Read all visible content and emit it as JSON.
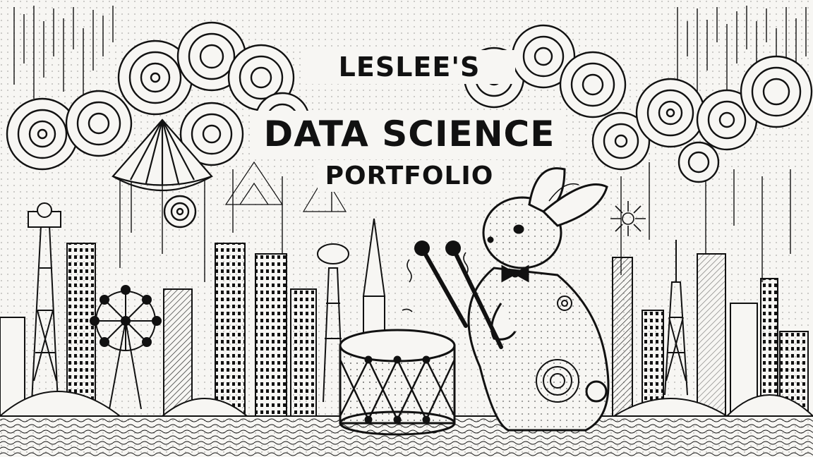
{
  "title": {
    "line1": "LESLEE'S",
    "line2": "DATA SCIENCE",
    "line3": "PORTFOLIO"
  },
  "colors": {
    "ink": "#111111",
    "paper": "#f7f6f3"
  },
  "illustration": {
    "style": "black-and-white ink doodle",
    "icons": [
      "rabbit-drummer",
      "drum",
      "drumsticks",
      "bow-tie",
      "ferris-wheel",
      "radio-tower",
      "city-skyline",
      "swirl-clouds",
      "circus-tent"
    ]
  }
}
